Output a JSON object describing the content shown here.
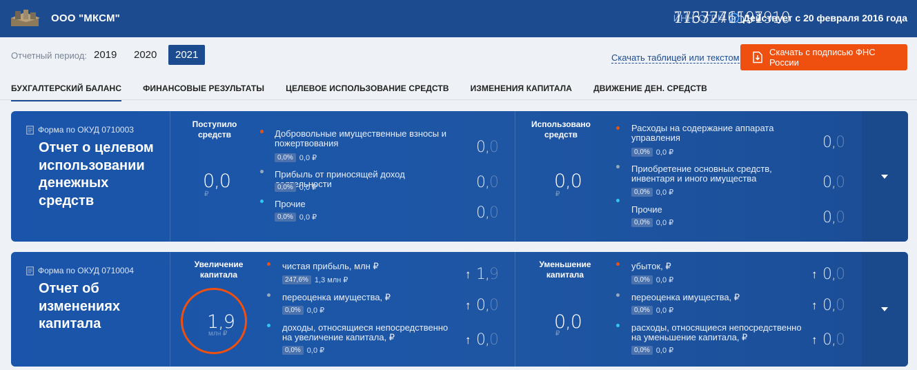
{
  "header": {
    "company": "ООО \"МКСМ\"",
    "inn_label": "ИНН",
    "inn": "7733271597",
    "ogrn_label": "ОГРН",
    "ogrn": "1167746191910",
    "status": "Действует с 20 февраля 2016 года"
  },
  "period": {
    "label": "Отчетный период:",
    "years": [
      "2019",
      "2020",
      "2021"
    ],
    "selected": "2021"
  },
  "actions": {
    "download_table": "Скачать таблицей или текстом",
    "download_fns": "Скачать с подписью ФНС России"
  },
  "tabs": [
    "БУХГАЛТЕРСКИЙ БАЛАНС",
    "ФИНАНСОВЫЕ РЕЗУЛЬТАТЫ",
    "ЦЕЛЕВОЕ ИСПОЛЬЗОВАНИЕ СРЕДСТВ",
    "ИЗМЕНЕНИЯ КАПИТАЛА",
    "ДВИЖЕНИЕ ДЕН. СРЕДСТВ"
  ],
  "card1": {
    "form": "Форма по ОКУД 0710003",
    "title": "Отчет о целевом использовании денежных средств",
    "left_head": "Поступило средств",
    "left_total": "0,0",
    "left_unit": "₽",
    "left_items": [
      {
        "label": "Добровольные имущественные взносы и пожертвования",
        "pct": "0,0%",
        "sub": "0,0 ₽",
        "v1": "0,",
        "v2": "0"
      },
      {
        "label": "Прибыль от приносящей доход деятельности",
        "pct": "0,0%",
        "sub": "0,0 ₽",
        "v1": "0,",
        "v2": "0"
      },
      {
        "label": "Прочие",
        "pct": "0,0%",
        "sub": "0,0 ₽",
        "v1": "0,",
        "v2": "0"
      }
    ],
    "right_head": "Использовано средств",
    "right_total": "0,0",
    "right_unit": "₽",
    "right_items": [
      {
        "label": "Расходы на содержание аппарата управления",
        "pct": "0,0%",
        "sub": "0,0 ₽",
        "v1": "0,",
        "v2": "0"
      },
      {
        "label": "Приобретение основных средств, инвентаря и иного имущества",
        "pct": "0,0%",
        "sub": "0,0 ₽",
        "v1": "0,",
        "v2": "0"
      },
      {
        "label": "Прочие",
        "pct": "0,0%",
        "sub": "0,0 ₽",
        "v1": "0,",
        "v2": "0"
      }
    ]
  },
  "card2": {
    "form": "Форма по ОКУД 0710004",
    "title": "Отчет об изменениях капитала",
    "left_head": "Увеличение капитала",
    "left_total": "1,9",
    "left_unit": "млн ₽",
    "left_items": [
      {
        "label": "чистая прибыль, млн ₽",
        "pct": "247,6%",
        "sub": "1,3 млн ₽",
        "v1": "1,",
        "v2": "9"
      },
      {
        "label": "переоценка имущества, ₽",
        "pct": "0,0%",
        "sub": "0,0 ₽",
        "v1": "0,",
        "v2": "0"
      },
      {
        "label": "доходы, относящиеся непосредственно на увеличение капитала, ₽",
        "pct": "0,0%",
        "sub": "0,0 ₽",
        "v1": "0,",
        "v2": "0"
      }
    ],
    "right_head": "Уменьшение капитала",
    "right_total": "0,0",
    "right_unit": "₽",
    "right_items": [
      {
        "label": "убыток, ₽",
        "pct": "0,0%",
        "sub": "0,0 ₽",
        "v1": "0,",
        "v2": "0"
      },
      {
        "label": "переоценка имущества, ₽",
        "pct": "0,0%",
        "sub": "0,0 ₽",
        "v1": "0,",
        "v2": "0"
      },
      {
        "label": "расходы, относящиеся непосредственно на уменьшение капитала, ₽",
        "pct": "0,0%",
        "sub": "0,0 ₽",
        "v1": "0,",
        "v2": "0"
      }
    ]
  }
}
